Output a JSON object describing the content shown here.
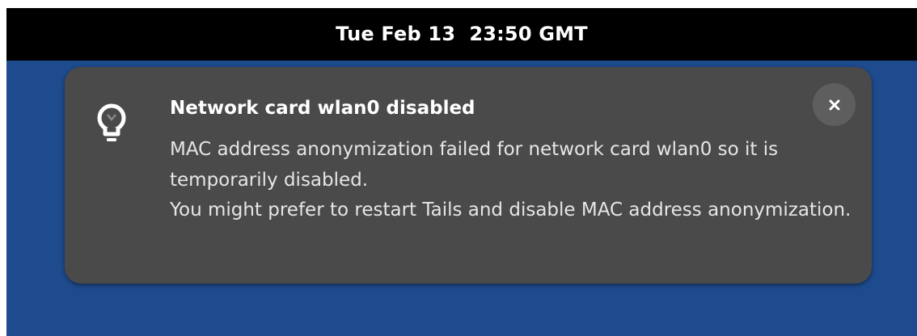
{
  "topbar": {
    "clock": "Tue Feb 13  23:50 GMT"
  },
  "notification": {
    "icon": "lightbulb-icon",
    "title": "Network card wlan0 disabled",
    "body_lines": [
      "MAC address anonymization failed for network card wlan0 so it is temporarily disabled.",
      "You might prefer to restart Tails and disable MAC address anonymization."
    ],
    "close_icon": "close-icon"
  },
  "colors": {
    "desktop_background": "#1e4b8e",
    "topbar_background": "#000000",
    "notification_background": "#4a4a4a",
    "close_button_background": "#5e5e5e"
  }
}
